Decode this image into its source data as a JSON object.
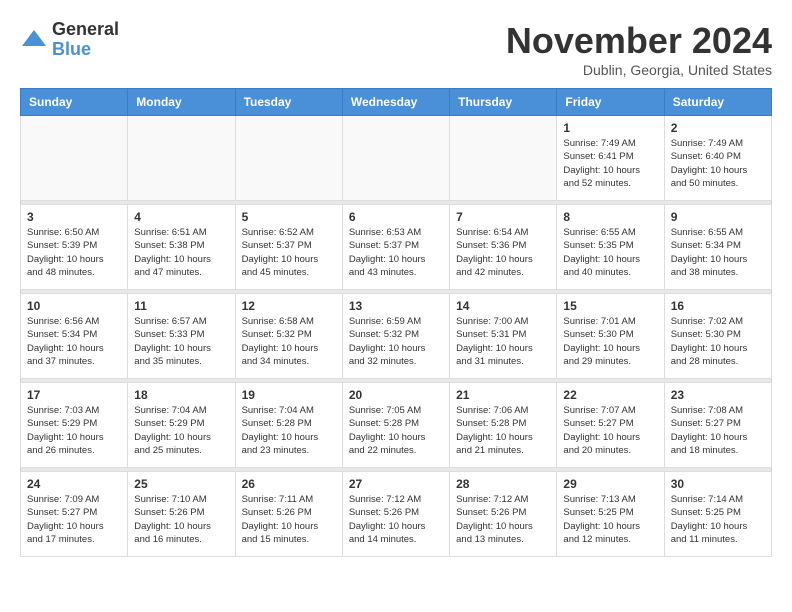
{
  "header": {
    "logo_general": "General",
    "logo_blue": "Blue",
    "month_title": "November 2024",
    "location": "Dublin, Georgia, United States"
  },
  "weekdays": [
    "Sunday",
    "Monday",
    "Tuesday",
    "Wednesday",
    "Thursday",
    "Friday",
    "Saturday"
  ],
  "weeks": [
    [
      {
        "day": "",
        "sunrise": "",
        "sunset": "",
        "daylight": ""
      },
      {
        "day": "",
        "sunrise": "",
        "sunset": "",
        "daylight": ""
      },
      {
        "day": "",
        "sunrise": "",
        "sunset": "",
        "daylight": ""
      },
      {
        "day": "",
        "sunrise": "",
        "sunset": "",
        "daylight": ""
      },
      {
        "day": "",
        "sunrise": "",
        "sunset": "",
        "daylight": ""
      },
      {
        "day": "1",
        "sunrise": "Sunrise: 7:49 AM",
        "sunset": "Sunset: 6:41 PM",
        "daylight": "Daylight: 10 hours and 52 minutes."
      },
      {
        "day": "2",
        "sunrise": "Sunrise: 7:49 AM",
        "sunset": "Sunset: 6:40 PM",
        "daylight": "Daylight: 10 hours and 50 minutes."
      }
    ],
    [
      {
        "day": "3",
        "sunrise": "Sunrise: 6:50 AM",
        "sunset": "Sunset: 5:39 PM",
        "daylight": "Daylight: 10 hours and 48 minutes."
      },
      {
        "day": "4",
        "sunrise": "Sunrise: 6:51 AM",
        "sunset": "Sunset: 5:38 PM",
        "daylight": "Daylight: 10 hours and 47 minutes."
      },
      {
        "day": "5",
        "sunrise": "Sunrise: 6:52 AM",
        "sunset": "Sunset: 5:37 PM",
        "daylight": "Daylight: 10 hours and 45 minutes."
      },
      {
        "day": "6",
        "sunrise": "Sunrise: 6:53 AM",
        "sunset": "Sunset: 5:37 PM",
        "daylight": "Daylight: 10 hours and 43 minutes."
      },
      {
        "day": "7",
        "sunrise": "Sunrise: 6:54 AM",
        "sunset": "Sunset: 5:36 PM",
        "daylight": "Daylight: 10 hours and 42 minutes."
      },
      {
        "day": "8",
        "sunrise": "Sunrise: 6:55 AM",
        "sunset": "Sunset: 5:35 PM",
        "daylight": "Daylight: 10 hours and 40 minutes."
      },
      {
        "day": "9",
        "sunrise": "Sunrise: 6:55 AM",
        "sunset": "Sunset: 5:34 PM",
        "daylight": "Daylight: 10 hours and 38 minutes."
      }
    ],
    [
      {
        "day": "10",
        "sunrise": "Sunrise: 6:56 AM",
        "sunset": "Sunset: 5:34 PM",
        "daylight": "Daylight: 10 hours and 37 minutes."
      },
      {
        "day": "11",
        "sunrise": "Sunrise: 6:57 AM",
        "sunset": "Sunset: 5:33 PM",
        "daylight": "Daylight: 10 hours and 35 minutes."
      },
      {
        "day": "12",
        "sunrise": "Sunrise: 6:58 AM",
        "sunset": "Sunset: 5:32 PM",
        "daylight": "Daylight: 10 hours and 34 minutes."
      },
      {
        "day": "13",
        "sunrise": "Sunrise: 6:59 AM",
        "sunset": "Sunset: 5:32 PM",
        "daylight": "Daylight: 10 hours and 32 minutes."
      },
      {
        "day": "14",
        "sunrise": "Sunrise: 7:00 AM",
        "sunset": "Sunset: 5:31 PM",
        "daylight": "Daylight: 10 hours and 31 minutes."
      },
      {
        "day": "15",
        "sunrise": "Sunrise: 7:01 AM",
        "sunset": "Sunset: 5:30 PM",
        "daylight": "Daylight: 10 hours and 29 minutes."
      },
      {
        "day": "16",
        "sunrise": "Sunrise: 7:02 AM",
        "sunset": "Sunset: 5:30 PM",
        "daylight": "Daylight: 10 hours and 28 minutes."
      }
    ],
    [
      {
        "day": "17",
        "sunrise": "Sunrise: 7:03 AM",
        "sunset": "Sunset: 5:29 PM",
        "daylight": "Daylight: 10 hours and 26 minutes."
      },
      {
        "day": "18",
        "sunrise": "Sunrise: 7:04 AM",
        "sunset": "Sunset: 5:29 PM",
        "daylight": "Daylight: 10 hours and 25 minutes."
      },
      {
        "day": "19",
        "sunrise": "Sunrise: 7:04 AM",
        "sunset": "Sunset: 5:28 PM",
        "daylight": "Daylight: 10 hours and 23 minutes."
      },
      {
        "day": "20",
        "sunrise": "Sunrise: 7:05 AM",
        "sunset": "Sunset: 5:28 PM",
        "daylight": "Daylight: 10 hours and 22 minutes."
      },
      {
        "day": "21",
        "sunrise": "Sunrise: 7:06 AM",
        "sunset": "Sunset: 5:28 PM",
        "daylight": "Daylight: 10 hours and 21 minutes."
      },
      {
        "day": "22",
        "sunrise": "Sunrise: 7:07 AM",
        "sunset": "Sunset: 5:27 PM",
        "daylight": "Daylight: 10 hours and 20 minutes."
      },
      {
        "day": "23",
        "sunrise": "Sunrise: 7:08 AM",
        "sunset": "Sunset: 5:27 PM",
        "daylight": "Daylight: 10 hours and 18 minutes."
      }
    ],
    [
      {
        "day": "24",
        "sunrise": "Sunrise: 7:09 AM",
        "sunset": "Sunset: 5:27 PM",
        "daylight": "Daylight: 10 hours and 17 minutes."
      },
      {
        "day": "25",
        "sunrise": "Sunrise: 7:10 AM",
        "sunset": "Sunset: 5:26 PM",
        "daylight": "Daylight: 10 hours and 16 minutes."
      },
      {
        "day": "26",
        "sunrise": "Sunrise: 7:11 AM",
        "sunset": "Sunset: 5:26 PM",
        "daylight": "Daylight: 10 hours and 15 minutes."
      },
      {
        "day": "27",
        "sunrise": "Sunrise: 7:12 AM",
        "sunset": "Sunset: 5:26 PM",
        "daylight": "Daylight: 10 hours and 14 minutes."
      },
      {
        "day": "28",
        "sunrise": "Sunrise: 7:12 AM",
        "sunset": "Sunset: 5:26 PM",
        "daylight": "Daylight: 10 hours and 13 minutes."
      },
      {
        "day": "29",
        "sunrise": "Sunrise: 7:13 AM",
        "sunset": "Sunset: 5:25 PM",
        "daylight": "Daylight: 10 hours and 12 minutes."
      },
      {
        "day": "30",
        "sunrise": "Sunrise: 7:14 AM",
        "sunset": "Sunset: 5:25 PM",
        "daylight": "Daylight: 10 hours and 11 minutes."
      }
    ]
  ]
}
